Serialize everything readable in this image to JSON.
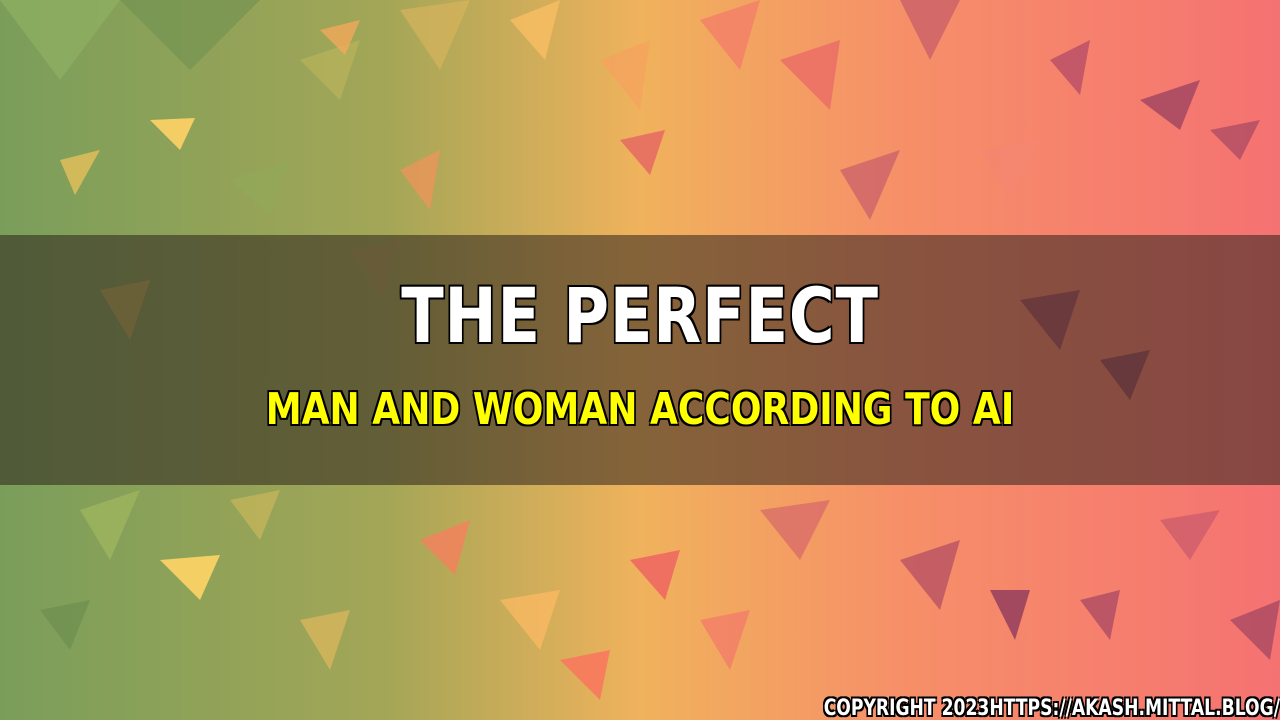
{
  "title": "THE PERFECT",
  "subtitle": "MAN AND WOMAN ACCORDING TO AI",
  "copyright": "COPYRIGHT 2023HTTPS://AKASH.MITTAL.BLOG/",
  "colors": {
    "background_left": "#7a9e5a",
    "background_mid": "#f0b25c",
    "background_right": "#f57272",
    "band": "#2d231e",
    "title": "#ffffff",
    "subtitle": "#ffff00",
    "outline": "#000000"
  }
}
